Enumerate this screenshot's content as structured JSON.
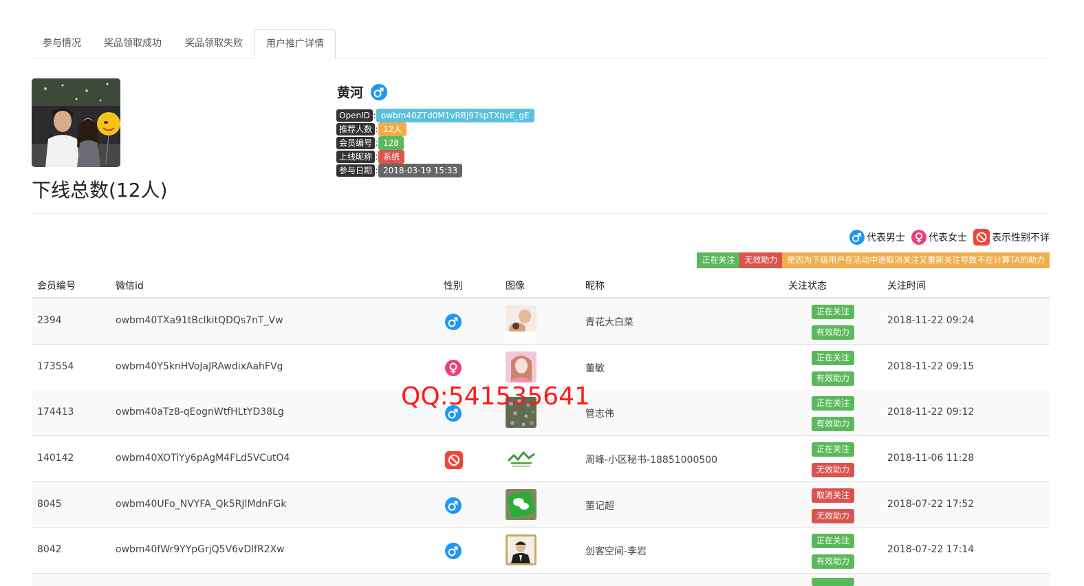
{
  "tabs": [
    "参与情况",
    "奖品领取成功",
    "奖品领取失败",
    "用户推广详情"
  ],
  "active_tab": 3,
  "profile": {
    "name": "黄河",
    "gender_icon": "male-icon",
    "info": [
      {
        "key": "OpenID",
        "value": "owbm40ZTd0M1vRBj97spTXqvE_gE",
        "color": "#5bc0de"
      },
      {
        "key": "推荐人数",
        "value": "12人",
        "color": "#f0ad4e"
      },
      {
        "key": "会员编号",
        "value": "128",
        "color": "#5cb85c"
      },
      {
        "key": "上线昵称",
        "value": "系统",
        "color": "#d9534f"
      },
      {
        "key": "参与日期",
        "value": "2018-03-19 15:33",
        "color": "#666666"
      }
    ]
  },
  "total_title": "下线总数(12人)",
  "legend": [
    {
      "icon": "male-icon",
      "label": "代表男士"
    },
    {
      "icon": "female-icon",
      "label": "代表女士"
    },
    {
      "icon": "unknown-gender-icon",
      "label": "表示性别不详"
    }
  ],
  "notes": [
    {
      "text": "正在关注",
      "color": "#5cb85c"
    },
    {
      "text": "无效助力",
      "color": "#d9534f"
    },
    {
      "text": "是因为下级用户在活动中途取消关注又重新关注导致不在计算TA的助力",
      "color": "#f0ad4e"
    }
  ],
  "table": {
    "headers": [
      "会员编号",
      "微信id",
      "性别",
      "图像",
      "昵称",
      "关注状态",
      "关注时间"
    ],
    "rows": [
      {
        "id": "2394",
        "wxid": "owbm40TXa91tBclkitQDQs7nT_Vw",
        "gender": "male",
        "nickname": "青花大白菜",
        "status1": "正在关注",
        "status2": "有效助力",
        "time": "2018-11-22 09:24",
        "thumb": "baby"
      },
      {
        "id": "173554",
        "wxid": "owbm40Y5knHVoJaJRAwdixAahFVg",
        "gender": "female",
        "nickname": "董敏",
        "status1": "正在关注",
        "status2": "有效助力",
        "time": "2018-11-22 09:15",
        "thumb": "woman"
      },
      {
        "id": "174413",
        "wxid": "owbm40aTz8-qEognWtfHLtYD38Lg",
        "gender": "male",
        "nickname": "管志伟",
        "status1": "正在关注",
        "status2": "有效助力",
        "time": "2018-11-22 09:12",
        "thumb": "flowers"
      },
      {
        "id": "140142",
        "wxid": "owbm40XOTiYy6pAgM4FLd5VCutO4",
        "gender": "unknown",
        "nickname": "周峰-小区秘书-18851000500",
        "status1": "正在关注",
        "status2": "无效助力",
        "time": "2018-11-06 11:28",
        "thumb": "logo"
      },
      {
        "id": "8045",
        "wxid": "owbm40UFo_NVYFA_Qk5RJlMdnFGk",
        "gender": "male",
        "nickname": "董记超",
        "status1": "取消关注",
        "status2": "无效助力",
        "time": "2018-07-22 17:52",
        "thumb": "wechat"
      },
      {
        "id": "8042",
        "wxid": "owbm40fWr9YYpGrjQ5V6vDlfR2Xw",
        "gender": "male",
        "nickname": "创客空间-李岩",
        "status1": "正在关注",
        "status2": "有效助力",
        "time": "2018-07-22 17:14",
        "thumb": "portrait"
      }
    ]
  },
  "watermark": "QQ:541535641",
  "colors": {
    "male": "#2196f3",
    "female": "#ec407a",
    "unknown": "#f44336",
    "green": "#5cb85c",
    "red": "#d9534f",
    "orange": "#f0ad4e",
    "cyan": "#5bc0de"
  }
}
